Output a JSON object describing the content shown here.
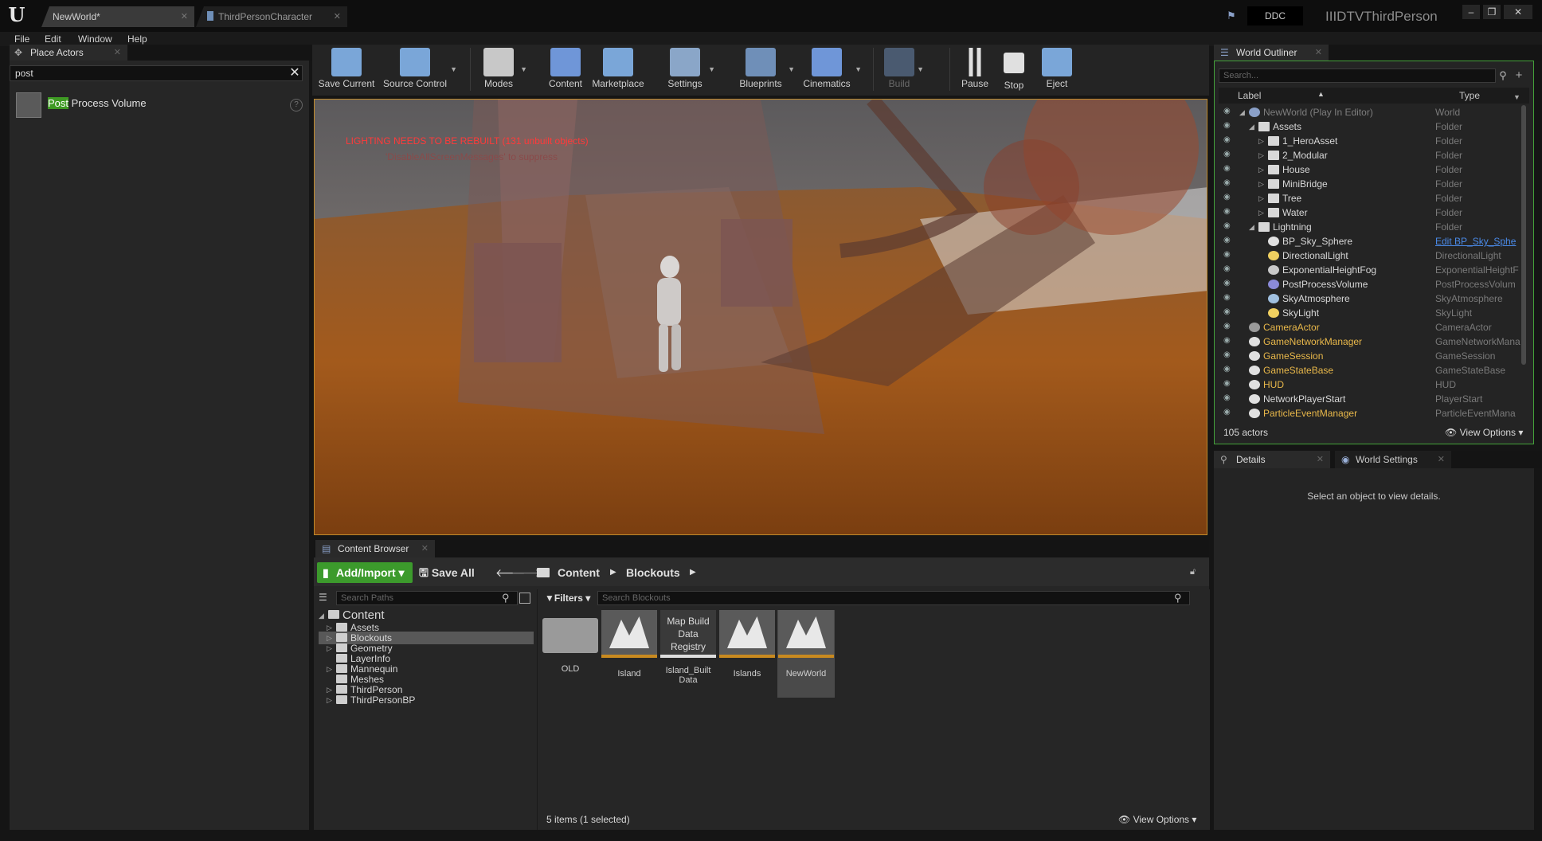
{
  "window": {
    "tabs": [
      {
        "label": "NewWorld*"
      },
      {
        "label": "ThirdPersonCharacter"
      }
    ],
    "ddc_label": "DDC",
    "project_name": "IIIDTVThirdPerson",
    "controls": [
      "–",
      "❐",
      "✕"
    ]
  },
  "menu": [
    "File",
    "Edit",
    "Window",
    "Help"
  ],
  "place_actors": {
    "tab_label": "Place Actors",
    "search_value": "post",
    "result_highlight": "Post",
    "result_rest": " Process Volume"
  },
  "toolbar": [
    {
      "label": "Save Current",
      "icon": "save-icon",
      "dropdown": false,
      "disabled": false
    },
    {
      "label": "Source Control",
      "icon": "source-control-icon",
      "dropdown": true,
      "disabled": false
    },
    {
      "label": "Modes",
      "icon": "modes-icon",
      "dropdown": true,
      "disabled": false
    },
    {
      "label": "Content",
      "icon": "content-icon",
      "dropdown": false,
      "disabled": false
    },
    {
      "label": "Marketplace",
      "icon": "marketplace-icon",
      "dropdown": false,
      "disabled": false
    },
    {
      "label": "Settings",
      "icon": "settings-icon",
      "dropdown": true,
      "disabled": false
    },
    {
      "label": "Blueprints",
      "icon": "blueprints-icon",
      "dropdown": true,
      "disabled": false
    },
    {
      "label": "Cinematics",
      "icon": "cinematics-icon",
      "dropdown": true,
      "disabled": false
    },
    {
      "label": "Build",
      "icon": "build-icon",
      "dropdown": true,
      "disabled": true
    },
    {
      "label": "Pause",
      "icon": "pause-icon",
      "dropdown": false,
      "disabled": false
    },
    {
      "label": "Stop",
      "icon": "stop-icon",
      "dropdown": false,
      "disabled": false
    },
    {
      "label": "Eject",
      "icon": "eject-icon",
      "dropdown": false,
      "disabled": false
    }
  ],
  "viewport": {
    "warning": "LIGHTING NEEDS TO BE REBUILT (131 unbuilt objects)",
    "suppress_hint": "'DisableAllScreenMessages' to suppress"
  },
  "outliner": {
    "tab_label": "World Outliner",
    "search_placeholder": "Search...",
    "col_label": "Label",
    "col_type": "Type",
    "rows": [
      {
        "label": "NewWorld (Play In Editor)",
        "type": "World",
        "style": "gray",
        "kind": "world"
      },
      {
        "label": "Assets",
        "type": "Folder",
        "style": "",
        "kind": "folder"
      },
      {
        "label": "1_HeroAsset",
        "type": "Folder",
        "style": "",
        "kind": "folder"
      },
      {
        "label": "2_Modular",
        "type": "Folder",
        "style": "",
        "kind": "folder"
      },
      {
        "label": "House",
        "type": "Folder",
        "style": "",
        "kind": "folder"
      },
      {
        "label": "MiniBridge",
        "type": "Folder",
        "style": "",
        "kind": "folder"
      },
      {
        "label": "Tree",
        "type": "Folder",
        "style": "",
        "kind": "folder"
      },
      {
        "label": "Water",
        "type": "Folder",
        "style": "",
        "kind": "folder"
      },
      {
        "label": "Lightning",
        "type": "Folder",
        "style": "",
        "kind": "folder"
      },
      {
        "label": "BP_Sky_Sphere",
        "type": "Edit BP_Sky_Sphe",
        "style": "",
        "kind": "actor",
        "link": true
      },
      {
        "label": "DirectionalLight",
        "type": "DirectionalLight",
        "style": "",
        "kind": "light"
      },
      {
        "label": "ExponentialHeightFog",
        "type": "ExponentialHeightF",
        "style": "",
        "kind": "fog"
      },
      {
        "label": "PostProcessVolume",
        "type": "PostProcessVolum",
        "style": "",
        "kind": "volume"
      },
      {
        "label": "SkyAtmosphere",
        "type": "SkyAtmosphere",
        "style": "",
        "kind": "sky"
      },
      {
        "label": "SkyLight",
        "type": "SkyLight",
        "style": "",
        "kind": "light"
      },
      {
        "label": "CameraActor",
        "type": "CameraActor",
        "style": "gold",
        "kind": "camera"
      },
      {
        "label": "GameNetworkManager",
        "type": "GameNetworkMana",
        "style": "gold",
        "kind": "actor"
      },
      {
        "label": "GameSession",
        "type": "GameSession",
        "style": "gold",
        "kind": "actor"
      },
      {
        "label": "GameStateBase",
        "type": "GameStateBase",
        "style": "gold",
        "kind": "actor"
      },
      {
        "label": "HUD",
        "type": "HUD",
        "style": "gold",
        "kind": "actor"
      },
      {
        "label": "NetworkPlayerStart",
        "type": "PlayerStart",
        "style": "",
        "kind": "actor"
      },
      {
        "label": "ParticleEventManager",
        "type": "ParticleEventMana",
        "style": "gold",
        "kind": "actor"
      }
    ],
    "actor_count": "105 actors",
    "view_options": "View Options"
  },
  "details": {
    "tab_label": "Details",
    "world_settings_label": "World Settings",
    "empty_message": "Select an object to view details."
  },
  "content_browser": {
    "tab_label": "Content Browser",
    "add_import": "Add/Import",
    "save_all": "Save All",
    "breadcrumb": [
      "Content",
      "Blockouts"
    ],
    "paths_placeholder": "Search Paths",
    "filters": "Filters",
    "assets_placeholder": "Search Blockouts",
    "tree": [
      {
        "label": "Content",
        "level": 0,
        "expanded": true,
        "selected": false
      },
      {
        "label": "Assets",
        "level": 1,
        "expandable": true,
        "selected": false
      },
      {
        "label": "Blockouts",
        "level": 1,
        "expandable": true,
        "selected": true
      },
      {
        "label": "Geometry",
        "level": 1,
        "expandable": true,
        "selected": false
      },
      {
        "label": "LayerInfo",
        "level": 1,
        "expandable": false,
        "selected": false
      },
      {
        "label": "Mannequin",
        "level": 1,
        "expandable": true,
        "selected": false
      },
      {
        "label": "Meshes",
        "level": 1,
        "expandable": false,
        "selected": false
      },
      {
        "label": "ThirdPerson",
        "level": 1,
        "expandable": true,
        "selected": false
      },
      {
        "label": "ThirdPersonBP",
        "level": 1,
        "expandable": true,
        "selected": false
      }
    ],
    "assets": [
      {
        "label": "OLD",
        "kind": "folder",
        "selected": false
      },
      {
        "label": "Island",
        "kind": "map",
        "selected": false
      },
      {
        "label": "Island_BuiltData",
        "kind": "registry",
        "thumb_text": "Map Build Data Registry",
        "selected": false
      },
      {
        "label": "Islands",
        "kind": "map",
        "selected": false
      },
      {
        "label": "NewWorld",
        "kind": "map",
        "selected": true
      }
    ],
    "items_count": "5 items (1 selected)",
    "view_options": "View Options"
  }
}
